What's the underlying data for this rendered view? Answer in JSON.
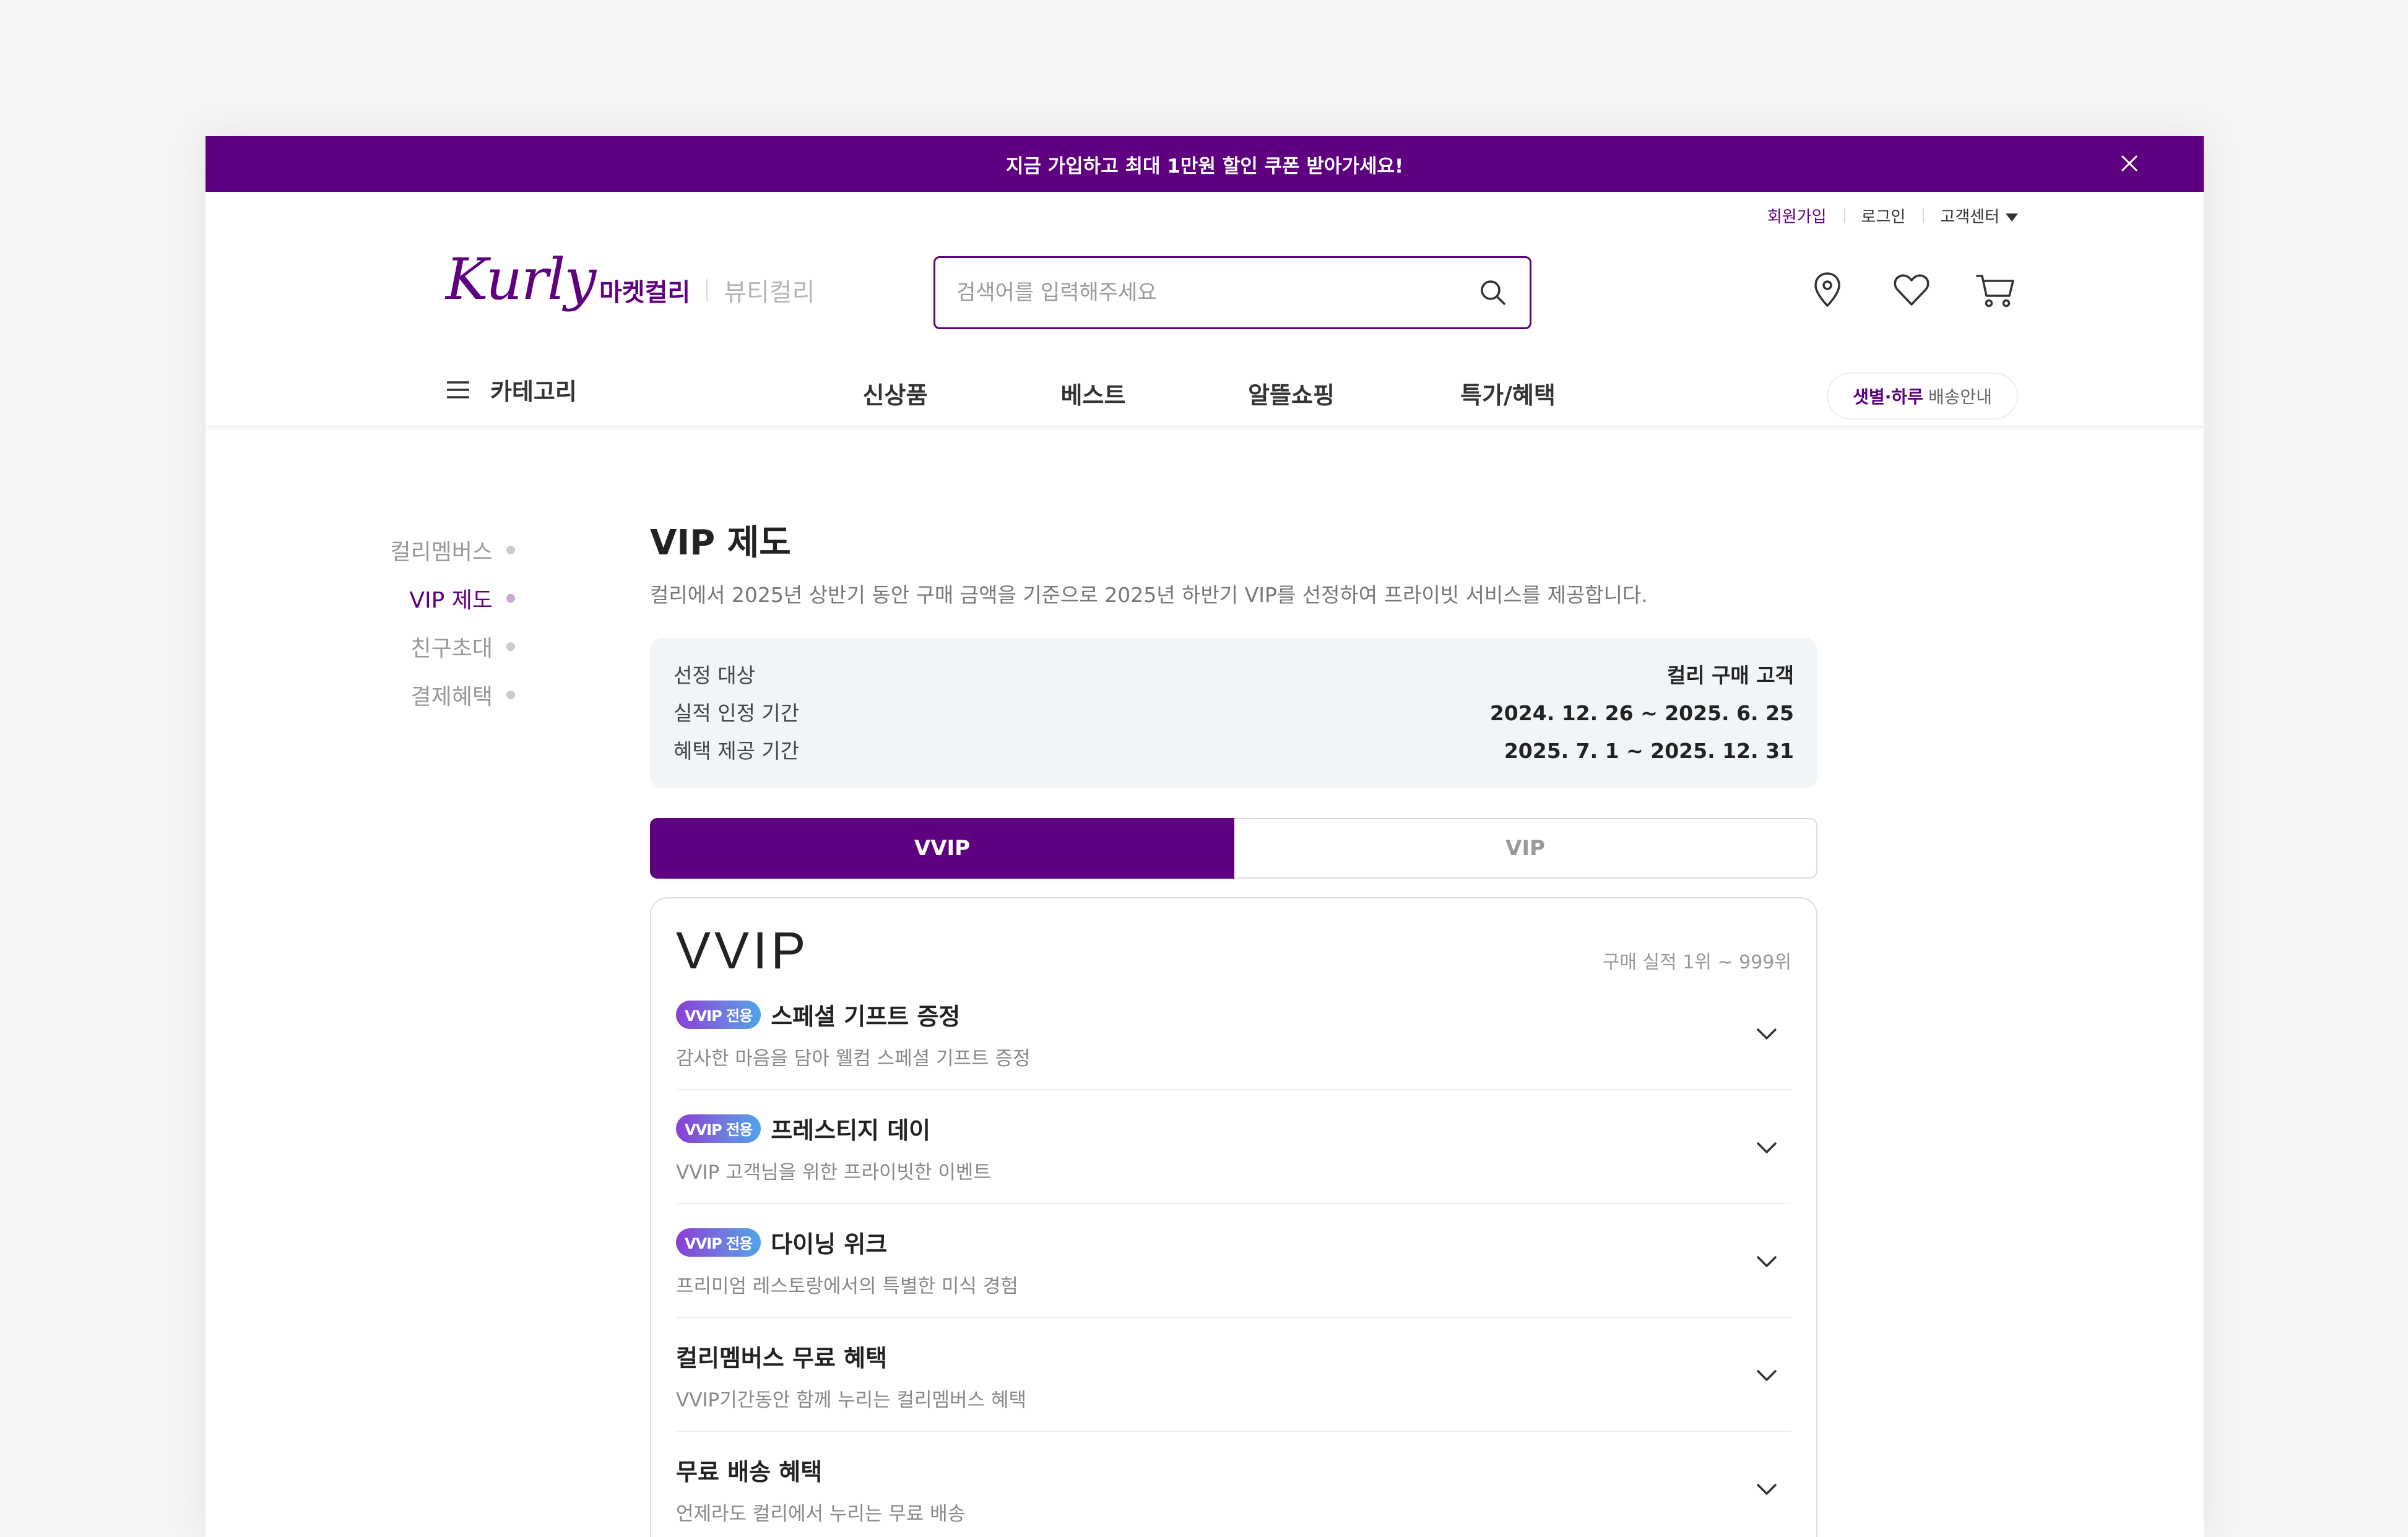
{
  "promo": {
    "prefix": "지금 가입하고 ",
    "highlight": "최대 1만원 할인 쿠폰",
    "suffix": " 받아가세요!"
  },
  "user_menu": {
    "signup": "회원가입",
    "login": "로그인",
    "support": "고객센터"
  },
  "brand": {
    "logo": "Kurly",
    "market": "마켓컬리",
    "beauty": "뷰티컬리",
    "accent_color": "#5f0080"
  },
  "search": {
    "placeholder": "검색어를 입력해주세요",
    "value": ""
  },
  "icons": {
    "location": "location-pin-icon",
    "wishlist": "heart-icon",
    "cart": "cart-icon"
  },
  "gnb": {
    "category": "카테고리",
    "links": [
      "신상품",
      "베스트",
      "알뜰쇼핑",
      "특가/혜택"
    ],
    "delivery_accent": "샛별·하루",
    "delivery_label": "배송안내"
  },
  "side_nav": [
    "컬리멤버스",
    "VIP 제도",
    "친구초대",
    "결제혜택"
  ],
  "page": {
    "title": "VIP 제도",
    "description": "컬리에서 2025년 상반기 동안 구매 금액을 기준으로 2025년 하반기 VIP를 선정하여 프라이빗 서비스를 제공합니다."
  },
  "info": [
    {
      "label": "선정 대상",
      "value": "컬리 구매 고객"
    },
    {
      "label": "실적 인정 기간",
      "value": "2024. 12. 26 ~ 2025. 6. 25"
    },
    {
      "label": "혜택 제공 기간",
      "value": "2025. 7. 1 ~ 2025. 12. 31"
    }
  ],
  "tabs": [
    "VVIP",
    "VIP"
  ],
  "card": {
    "title": "VVIP",
    "range": "구매 실적 1위 ~ 999위",
    "badge": "VVIP 전용",
    "benefits": [
      {
        "title": "스페셜 기프트 증정",
        "desc": "감사한 마음을 담아 웰컴 스페셜 기프트 증정"
      },
      {
        "title": "프레스티지 데이",
        "desc": "VVIP 고객님을 위한 프라이빗한 이벤트"
      },
      {
        "title": "다이닝 위크",
        "desc": "프리미엄 레스토랑에서의 특별한 미식 경험"
      },
      {
        "title": "컬리멤버스 무료 혜택",
        "desc": "VVIP기간동안 함께 누리는 컬리멤버스 혜택"
      },
      {
        "title": "무료 배송 혜택",
        "desc": "언제라도 컬리에서 누리는 무료 배송"
      }
    ]
  }
}
